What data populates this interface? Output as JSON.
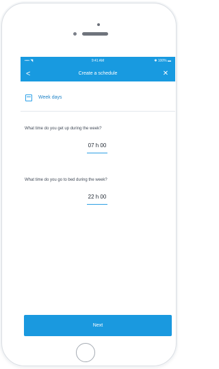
{
  "statusbar": {
    "left": "•••• ◥",
    "time": "9:41 AM",
    "right": "✱ 100% ▬"
  },
  "nav": {
    "back_icon": "<",
    "title": "Create a schedule",
    "close_icon": "✕"
  },
  "section": {
    "icon": "calendar-icon",
    "label": "Week days"
  },
  "questions": [
    {
      "text": "What time do you get up during the week?",
      "value": "07 h 00"
    },
    {
      "text": "What time do you go to bed during the week?",
      "value": "22 h 00"
    }
  ],
  "actions": {
    "next_label": "Next"
  },
  "colors": {
    "accent": "#189ae0",
    "text": "#404956",
    "link": "#2184c8"
  }
}
